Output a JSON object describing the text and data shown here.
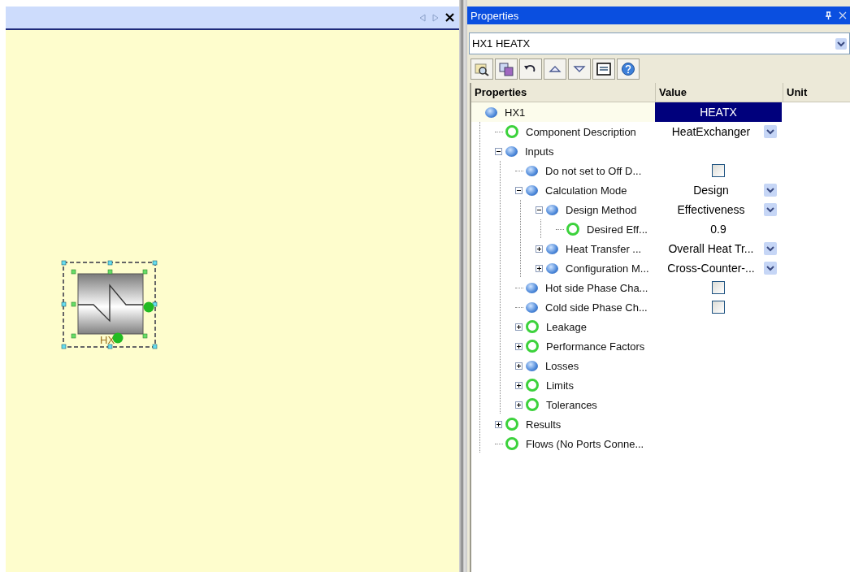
{
  "canvas": {
    "component_label": "HX"
  },
  "properties": {
    "title": "Properties",
    "selector": "HX1 HEATX",
    "columns": [
      "Properties",
      "Value",
      "Unit"
    ],
    "tree": [
      {
        "label": "HX1",
        "kind": "sphere",
        "selected": true,
        "value": {
          "kind": "text",
          "text": "HEATX"
        },
        "children": [
          {
            "label": "Component Description",
            "kind": "ring",
            "selected": false,
            "value": {
              "kind": "dropdown",
              "text": "HeatExchanger"
            }
          },
          {
            "label": "Inputs",
            "kind": "sphere",
            "selected": false,
            "expanded": true,
            "children": [
              {
                "label": "Do not set to Off D...",
                "kind": "sphere",
                "selected": false,
                "value": {
                  "kind": "checkbox",
                  "checked": false
                }
              },
              {
                "label": "Calculation Mode",
                "kind": "sphere",
                "selected": false,
                "expanded": true,
                "value": {
                  "kind": "dropdown",
                  "text": "Design"
                },
                "children": [
                  {
                    "label": "Design Method",
                    "kind": "sphere",
                    "selected": false,
                    "expanded": true,
                    "value": {
                      "kind": "dropdown",
                      "text": "Effectiveness"
                    },
                    "children": [
                      {
                        "label": "Desired Eff...",
                        "kind": "ring",
                        "selected": false,
                        "value": {
                          "kind": "text",
                          "text": "0.9"
                        }
                      }
                    ]
                  },
                  {
                    "label": "Heat Transfer ...",
                    "kind": "sphere",
                    "selected": false,
                    "expanded": false,
                    "value": {
                      "kind": "dropdown",
                      "text": "Overall Heat Tr..."
                    }
                  },
                  {
                    "label": "Configuration M...",
                    "kind": "sphere",
                    "selected": false,
                    "expanded": false,
                    "value": {
                      "kind": "dropdown",
                      "text": "Cross-Counter-..."
                    }
                  }
                ]
              },
              {
                "label": "Hot side Phase Cha...",
                "kind": "sphere",
                "selected": false,
                "value": {
                  "kind": "checkbox",
                  "checked": false
                }
              },
              {
                "label": "Cold side Phase Ch...",
                "kind": "sphere",
                "selected": false,
                "value": {
                  "kind": "checkbox",
                  "checked": false
                }
              },
              {
                "label": "Leakage",
                "kind": "ring",
                "selected": false,
                "expanded": false
              },
              {
                "label": "Performance Factors",
                "kind": "ring",
                "selected": false,
                "expanded": false
              },
              {
                "label": "Losses",
                "kind": "sphere",
                "selected": false,
                "expanded": false
              },
              {
                "label": "Limits",
                "kind": "ring",
                "selected": false,
                "expanded": false
              },
              {
                "label": "Tolerances",
                "kind": "ring",
                "selected": false,
                "expanded": false
              }
            ]
          },
          {
            "label": "Results",
            "kind": "ring",
            "selected": false,
            "expanded": false
          },
          {
            "label": "Flows (No Ports Conne...",
            "kind": "ring",
            "selected": false
          }
        ]
      }
    ]
  }
}
